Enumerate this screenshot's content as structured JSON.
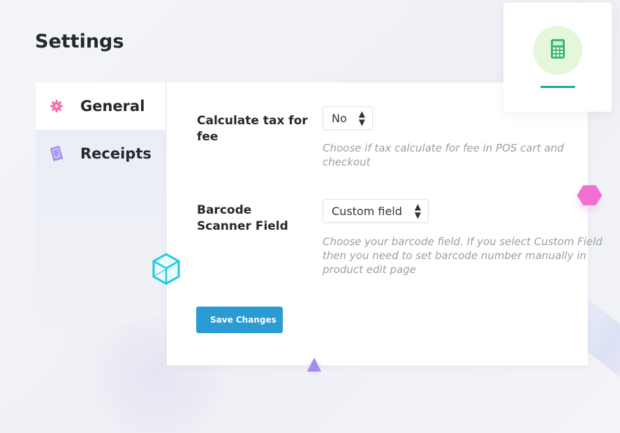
{
  "page": {
    "title": "Settings"
  },
  "sidebar": {
    "items": [
      {
        "label": "General",
        "icon": "gear-icon",
        "icon_color": "#f06fa8",
        "active": true
      },
      {
        "label": "Receipts",
        "icon": "receipt-icon",
        "icon_color": "#8a6fe0",
        "active": false
      }
    ]
  },
  "settings": {
    "tax_fee": {
      "label": "Calculate tax for fee",
      "value": "No",
      "description": "Choose if tax calculate for fee in POS cart and checkout"
    },
    "barcode": {
      "label": "Barcode Scanner Field",
      "value": "Custom field",
      "description": "Choose your barcode field. If you select Custom Field then you need to set barcode number manually in product edit page"
    }
  },
  "actions": {
    "save_label": "Save Changes"
  },
  "card": {
    "icon": "calculator-icon",
    "accent_color": "#1ea896",
    "circle_color": "#e4f7d9"
  },
  "colors": {
    "primary_button": "#2b9bd3",
    "decor_pink": "#f06fd0",
    "decor_cyan": "#28c7e0",
    "decor_purple": "#a58af0"
  }
}
